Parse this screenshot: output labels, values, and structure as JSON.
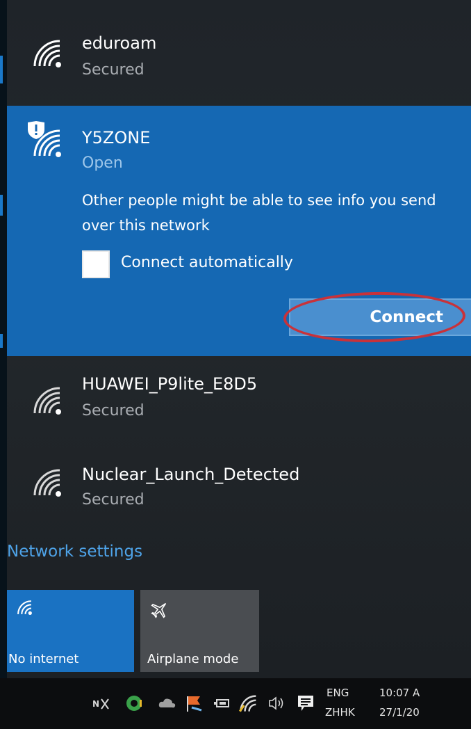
{
  "networks_top": [
    {
      "ssid": "eduroam",
      "status": "Secured",
      "icon": "wifi-signal-icon"
    }
  ],
  "selected_network": {
    "ssid": "Y5ZONE",
    "status": "Open",
    "icon": "wifi-shield-warning-icon",
    "warning": "Other people might be able to see info you send over this network",
    "auto_connect_label": "Connect automatically",
    "auto_connect_checked": false,
    "connect_label": "Connect"
  },
  "networks_bottom": [
    {
      "ssid": "HUAWEI_P9lite_E8D5",
      "status": "Secured",
      "icon": "wifi-signal-icon"
    },
    {
      "ssid": "Nuclear_Launch_Detected",
      "status": "Secured",
      "icon": "wifi-signal-icon"
    }
  ],
  "network_settings_label": "Network settings",
  "quick_actions": [
    {
      "label": "No internet",
      "icon": "wifi-icon",
      "active": true
    },
    {
      "label": "Airplane mode",
      "icon": "airplane-icon",
      "active": false
    }
  ],
  "taskbar": {
    "lang_top": "ENG",
    "lang_bottom": "ZHHK",
    "time": "10:07 A",
    "date": "27/1/20",
    "tray_icons": [
      "onenote-icon",
      "app-icon",
      "cloud-icon",
      "flag-icon",
      "battery-icon",
      "wifi-icon",
      "volume-icon",
      "notification-icon"
    ]
  },
  "colors": {
    "accent": "#1568b3",
    "link": "#4ea3e8",
    "annotation": "#c8323a"
  }
}
